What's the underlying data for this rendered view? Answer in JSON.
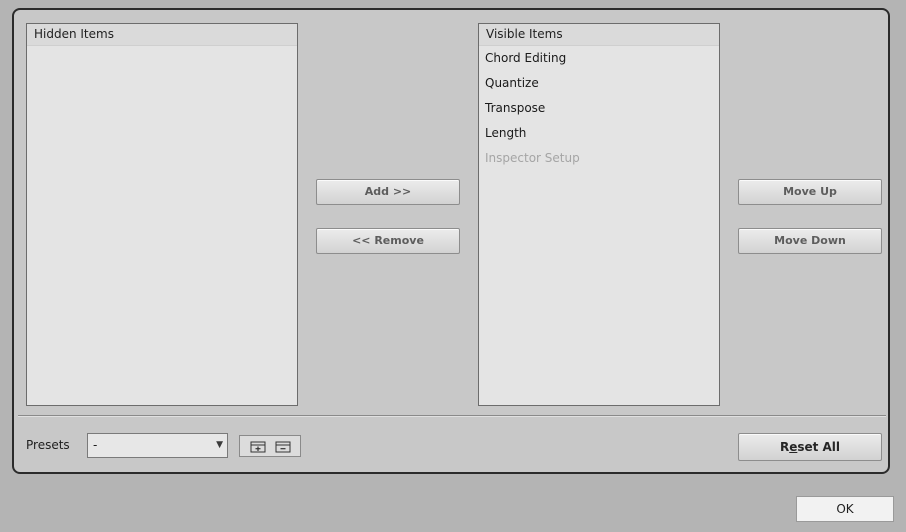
{
  "hidden_list": {
    "header": "Hidden Items",
    "items": []
  },
  "visible_list": {
    "header": "Visible Items",
    "items": [
      {
        "label": "Chord Editing",
        "enabled": true
      },
      {
        "label": "Quantize",
        "enabled": true
      },
      {
        "label": "Transpose",
        "enabled": true
      },
      {
        "label": "Length",
        "enabled": true
      },
      {
        "label": "Inspector Setup",
        "enabled": false
      }
    ]
  },
  "buttons": {
    "add": "Add >>",
    "remove": "<< Remove",
    "move_up": "Move Up",
    "move_down": "Move Down",
    "reset_all_prefix": "R",
    "reset_all_underlined": "e",
    "reset_all_suffix": "set All",
    "ok": "OK"
  },
  "presets": {
    "label": "Presets",
    "selected": "-"
  },
  "icons": {
    "dropdown": "chevron-down-icon",
    "save_preset": "save-preset-icon",
    "delete_preset": "delete-preset-icon"
  }
}
